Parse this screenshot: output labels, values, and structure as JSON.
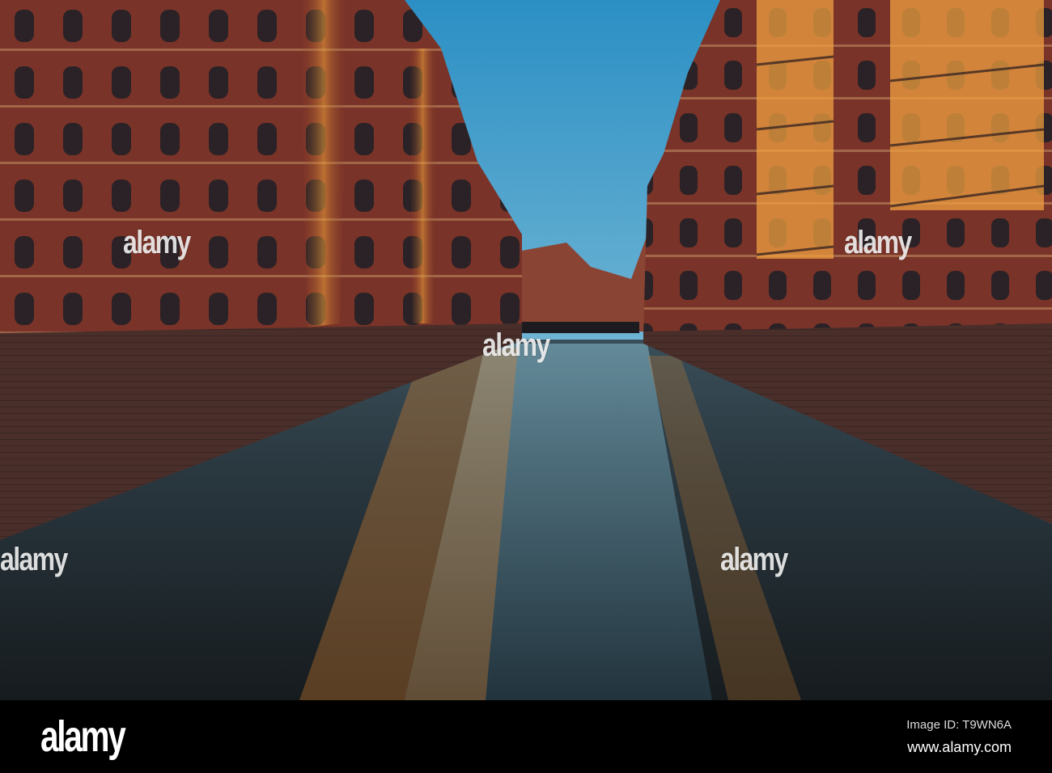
{
  "photo": {
    "subject": "canal-between-brick-warehouses"
  },
  "watermark": {
    "text": "alamy"
  },
  "footer": {
    "logo": "alamy",
    "image_id": "Image ID: T9WN6A",
    "website": "www.alamy.com"
  },
  "colors": {
    "sky_top": "#2b8fc4",
    "sky_bottom": "#b5dbe4",
    "brick": "#7a3328",
    "water": "#1c2226",
    "glow": "#f2a33a"
  }
}
